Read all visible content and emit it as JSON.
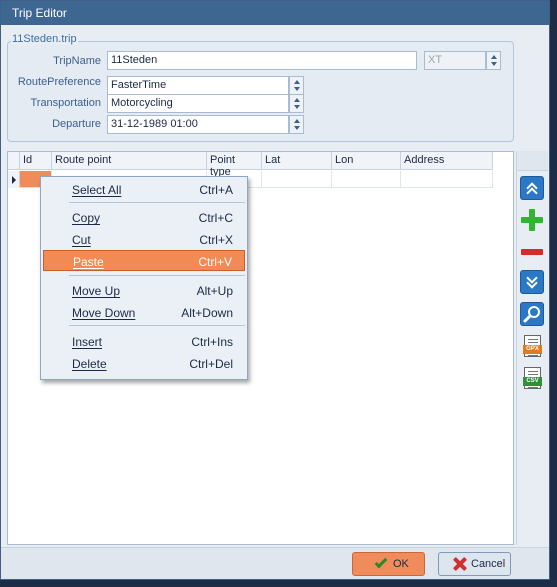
{
  "window": {
    "title": "Trip Editor"
  },
  "trip_group": {
    "caption": "11Steden.trip",
    "fields": {
      "trip_name": {
        "label": "TripName",
        "value": "11Steden"
      },
      "model": {
        "value": "XT"
      },
      "route_preference": {
        "label": "RoutePreference",
        "value": "FasterTime"
      },
      "transportation": {
        "label": "Transportation",
        "value": "Motorcycling"
      },
      "departure": {
        "label": "Departure",
        "value": "31-12-1989 01:00"
      }
    }
  },
  "grid": {
    "columns": [
      "Id",
      "Route point",
      "Point type",
      "Lat",
      "Lon",
      "Address"
    ],
    "rows": [
      [
        "",
        "",
        "",
        "",
        "",
        ""
      ]
    ]
  },
  "sidebar": {
    "buttons": [
      "move-top-icon",
      "add-icon",
      "remove-icon",
      "move-bottom-icon",
      "search-icon",
      "gpx-file-icon",
      "csv-file-icon"
    ],
    "file_tags": {
      "gpx": "GPX",
      "csv": "CSV"
    }
  },
  "context_menu": {
    "items": [
      {
        "label": "Select All",
        "shortcut": "Ctrl+A"
      },
      {
        "label": "Copy",
        "shortcut": "Ctrl+C"
      },
      {
        "label": "Cut",
        "shortcut": "Ctrl+X"
      },
      {
        "label": "Paste",
        "shortcut": "Ctrl+V",
        "highlighted": true
      },
      {
        "label": "Move Up",
        "shortcut": "Alt+Up"
      },
      {
        "label": "Move Down",
        "shortcut": "Alt+Down"
      },
      {
        "label": "Insert",
        "shortcut": "Ctrl+Ins"
      },
      {
        "label": "Delete",
        "shortcut": "Ctrl+Del"
      }
    ]
  },
  "footer": {
    "ok_label": "OK",
    "cancel_label": "Cancel"
  },
  "colors": {
    "titlebar": "#3d6690",
    "accent": "#f08c5c",
    "highlight": "#f28a55",
    "link": "#3c6fa8"
  }
}
